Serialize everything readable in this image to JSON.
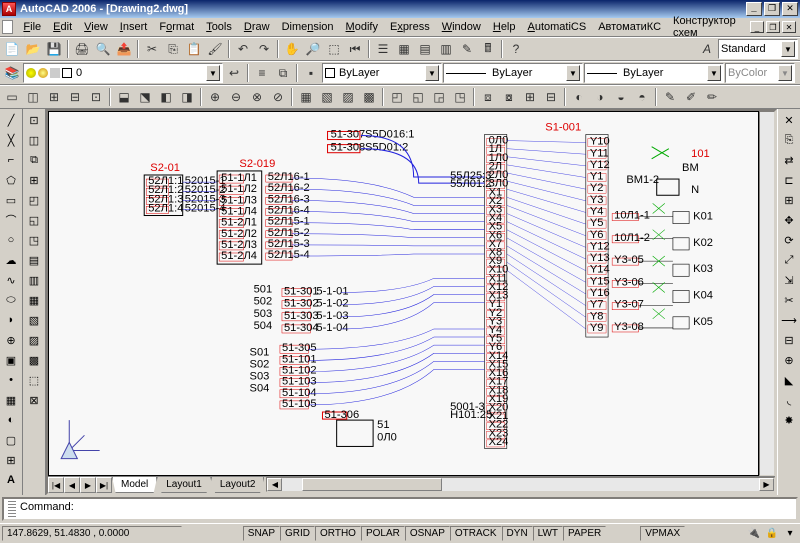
{
  "window": {
    "title": "AutoCAD 2006 - [Drawing2.dwg]",
    "min": "_",
    "restore": "❐",
    "close": "✕"
  },
  "menu": {
    "items": [
      "File",
      "Edit",
      "View",
      "Insert",
      "Format",
      "Tools",
      "Draw",
      "Dimension",
      "Modify",
      "Express",
      "Window",
      "Help",
      "AutomatiCS",
      "АвтоматиКС",
      "Конструктор схем"
    ]
  },
  "docbtns": {
    "min": "_",
    "restore": "❐",
    "close": "✕"
  },
  "styles": {
    "current": "Standard"
  },
  "layers": {
    "current": "0"
  },
  "linetype": {
    "current": "ByLayer"
  },
  "lineweight": {
    "current": "ByLayer"
  },
  "plotstyle": {
    "current": "ByColor"
  },
  "tabs": {
    "model": "Model",
    "layout1": "Layout1",
    "layout2": "Layout2"
  },
  "nav": {
    "first": "|◀",
    "prev": "◀",
    "next": "▶",
    "last": "▶|"
  },
  "command": {
    "prompt": "Command:"
  },
  "status": {
    "coords": "147.8629, 51.4830 , 0.0000",
    "toggles": [
      "SNAP",
      "GRID",
      "ORTHO",
      "POLAR",
      "OSNAP",
      "OTRACK",
      "DYN",
      "LWT",
      "PAPER"
    ],
    "vpmax": "VPMAX"
  },
  "schematic": {
    "labels": {
      "s1_001": "S1-001",
      "s2_01": "S2-01",
      "s2_019": "S2-019",
      "rows_a": [
        "52Л1:1",
        "52Л1:2",
        "52Л1:3",
        "52Л1:4"
      ],
      "mid_a": [
        "52015-1",
        "52015-2",
        "52015-3",
        "52015-4"
      ],
      "rows_b": [
        "51-1Л1",
        "51-1Л2",
        "51-1Л3",
        "51-1Л4",
        "51-2Л1",
        "51-2Л2",
        "51-2Л3",
        "51-2Л4"
      ],
      "mid_b": [
        "52Л16-1",
        "52Л16-2",
        "52Л16-3",
        "52Л16-4",
        "52Л15-1",
        "52Л15-2",
        "52Л15-3",
        "52Л15-4"
      ],
      "top_pair": [
        [
          "51-307",
          "S5D016:1"
        ],
        [
          "51-308",
          "S5D01:2"
        ]
      ],
      "s_list": [
        "501",
        "502",
        "503",
        "504"
      ],
      "s_nums": [
        "S01",
        "S02",
        "S03",
        "S04"
      ],
      "rows_c": [
        "51-301",
        "51-302",
        "51-303",
        "51-304"
      ],
      "mid_c": [
        "5-1-01",
        "5-1-02",
        "5-1-03",
        "5-1-04"
      ],
      "rows_d": [
        "51-305",
        "51-101",
        "51-102",
        "51-103",
        "51-104",
        "51-105"
      ],
      "bottom": [
        "51-306",
        "51",
        "0Л0"
      ],
      "x_left": [
        "55Л25:3",
        "55Л01:2"
      ],
      "x_pins": [
        "0Л0",
        "1Л",
        "1Л0",
        "2Л",
        "2Л0",
        "3Л0",
        "X1",
        "X2",
        "X3",
        "X4",
        "X5",
        "X6",
        "X7",
        "X8",
        "X9",
        "X10",
        "X11",
        "X12",
        "X13",
        "Y1",
        "Y2",
        "Y3",
        "Y4",
        "Y5",
        "Y6",
        "X14",
        "X15",
        "X16",
        "X17",
        "X18",
        "X19",
        "X20",
        "X21",
        "X22",
        "X23",
        "X24"
      ],
      "y_pins": [
        "Y10",
        "Y11",
        "Y12",
        "Y1",
        "Y2",
        "Y3",
        "Y4",
        "Y5",
        "Y6",
        "Y12",
        "Y13",
        "Y14",
        "Y15",
        "Y16",
        "Y7",
        "Y8",
        "Y9"
      ],
      "right_net": [
        "10Л1-1",
        "10Л1-2",
        "Y3-05",
        "Y3-06",
        "Y3-07",
        "Y3-08"
      ],
      "right_tag": [
        "K01",
        "K02",
        "K03",
        "K04",
        "K05"
      ],
      "bm": [
        "BM",
        "BM1-2",
        "N"
      ],
      "b_right": "101",
      "b_low": [
        "5001-3",
        "H101:25"
      ]
    }
  }
}
